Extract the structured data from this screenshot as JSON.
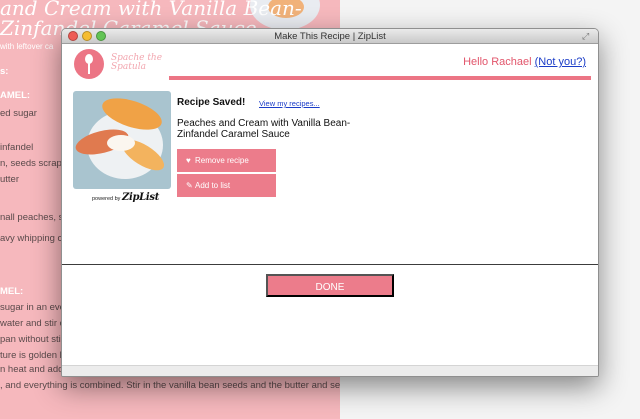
{
  "background": {
    "title": "and Cream with Vanilla Bean-\nZinfandel Caramel Sauce",
    "subtitle": "with leftover ca",
    "lines": [
      {
        "text": "s:",
        "head": true
      },
      {
        "text": "AMEL:",
        "head": true
      },
      {
        "text": "ed sugar",
        "head": false
      },
      {
        "text": "infandel",
        "head": false
      },
      {
        "text": "n, seeds scrape",
        "head": false
      },
      {
        "text": "utter",
        "head": false
      },
      {
        "text": "nall peaches, slic",
        "head": false
      },
      {
        "text": "avy whipping cre",
        "head": false
      },
      {
        "text": "MEL:",
        "head": true
      },
      {
        "text": "sugar in an ever",
        "head": false
      },
      {
        "text": "water and stir ove",
        "head": false
      },
      {
        "text": "pan without stirri",
        "head": false
      },
      {
        "text": "ture is golden br",
        "head": false
      },
      {
        "text": "n heat and add e",
        "head": false
      },
      {
        "text": ", and everything is combined. Stir in the vanilla bean seeds and the butter and serve",
        "head": false
      }
    ]
  },
  "window": {
    "title": "Make This Recipe | ZipList"
  },
  "header": {
    "logo_text": "Spache the Spatula",
    "greeting": "Hello Rachael",
    "not_you": "(Not you?)"
  },
  "recipe": {
    "status": "Recipe Saved!",
    "view_link": "View my recipes...",
    "name": "Peaches and Cream with Vanilla Bean-Zinfandel Caramel Sauce",
    "powered_by": "powered by",
    "powered_brand": "ZipList"
  },
  "actions": {
    "remove_label": "Remove recipe",
    "add_label": "Add to list",
    "done_label": "DONE"
  },
  "colors": {
    "accent": "#ec7c8b",
    "background_page": "#f6b8bd",
    "link": "#1a3cc8"
  },
  "icons": {
    "remove": "heart-icon",
    "add": "pencil-icon"
  }
}
